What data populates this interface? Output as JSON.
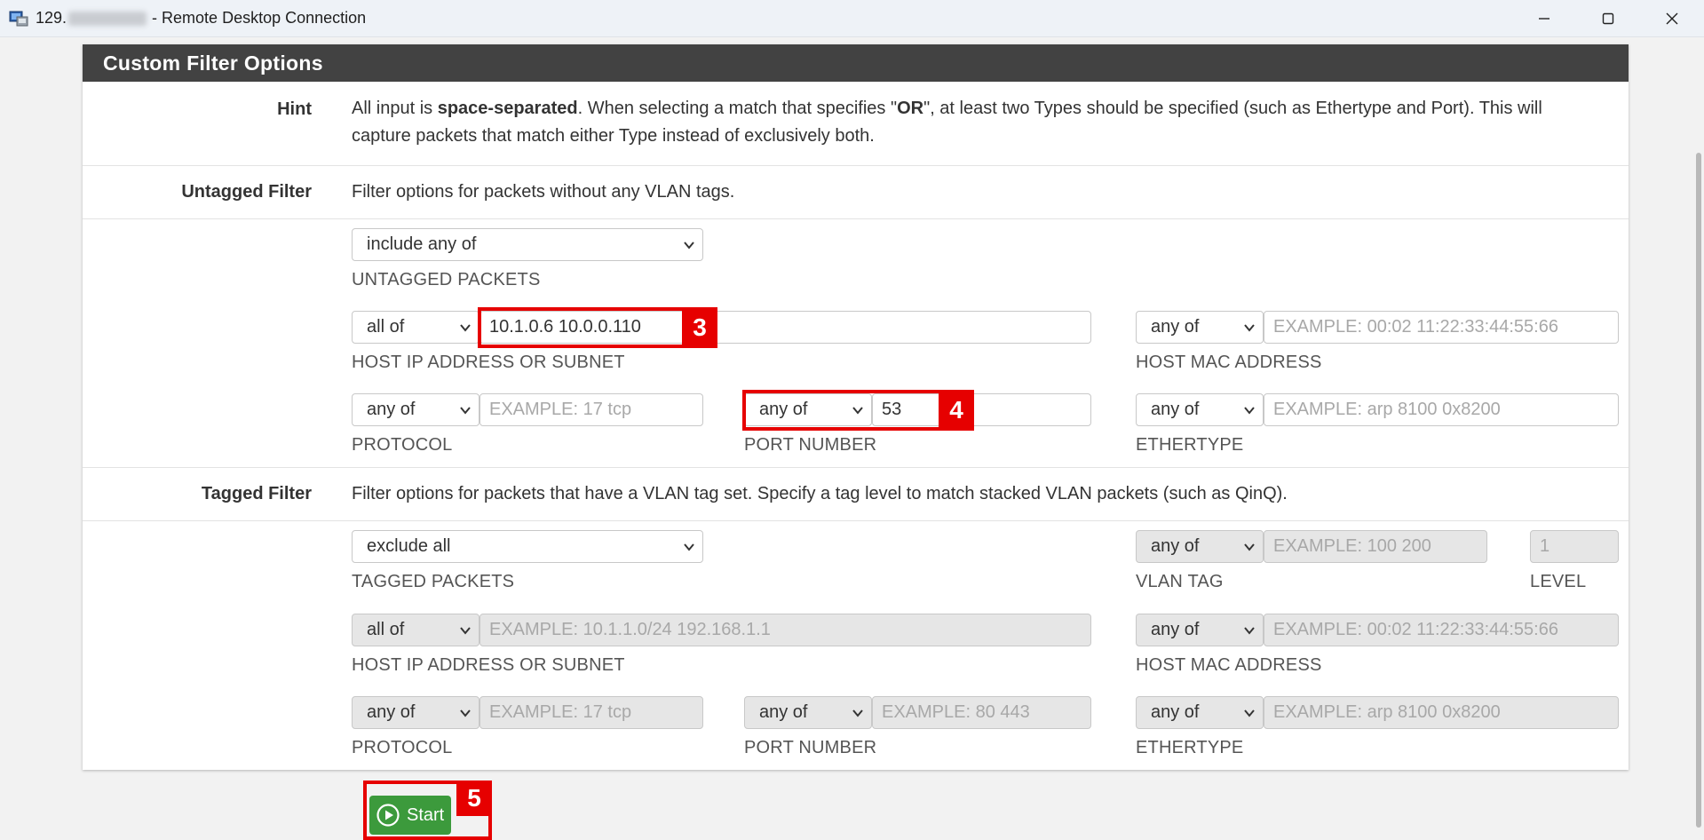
{
  "window": {
    "title_prefix": "129.",
    "title_suffix": "- Remote Desktop Connection"
  },
  "panel": {
    "heading": "Custom Filter Options"
  },
  "hint": {
    "label": "Hint",
    "text_part1": "All input is ",
    "text_bold1": "space-separated",
    "text_part2": ". When selecting a match that specifies \"",
    "text_bold2": "OR",
    "text_part3": "\", at least two Types should be specified (such as Ethertype and Port). This will",
    "text_line2": "capture packets that match either Type instead of exclusively both."
  },
  "untagged": {
    "label": "Untagged Filter",
    "description": "Filter options for packets without any VLAN tags.",
    "packets_select": "include any of",
    "packets_label": "UNTAGGED PACKETS",
    "host_ip_select": "all of",
    "host_ip_value": "10.1.0.6 10.0.0.110",
    "host_ip_label": "HOST IP ADDRESS OR SUBNET",
    "host_mac_select": "any of",
    "host_mac_placeholder": "EXAMPLE: 00:02 11:22:33:44:55:66",
    "host_mac_label": "HOST MAC ADDRESS",
    "protocol_select": "any of",
    "protocol_placeholder": "EXAMPLE: 17 tcp",
    "protocol_label": "PROTOCOL",
    "port_select": "any of",
    "port_value": "53",
    "port_label": "PORT NUMBER",
    "ethertype_select": "any of",
    "ethertype_placeholder": "EXAMPLE: arp 8100 0x8200",
    "ethertype_label": "ETHERTYPE"
  },
  "tagged": {
    "label": "Tagged Filter",
    "description": "Filter options for packets that have a VLAN tag set. Specify a tag level to match stacked VLAN packets (such as QinQ).",
    "packets_select": "exclude all",
    "packets_label": "TAGGED PACKETS",
    "vlan_select": "any of",
    "vlan_placeholder": "EXAMPLE: 100 200",
    "vlan_label": "VLAN TAG",
    "level_placeholder": "1",
    "level_label": "LEVEL",
    "host_ip_select": "all of",
    "host_ip_placeholder": "EXAMPLE: 10.1.1.0/24 192.168.1.1",
    "host_ip_label": "HOST IP ADDRESS OR SUBNET",
    "host_mac_select": "any of",
    "host_mac_placeholder": "EXAMPLE: 00:02 11:22:33:44:55:66",
    "host_mac_label": "HOST MAC ADDRESS",
    "protocol_select": "any of",
    "protocol_placeholder": "EXAMPLE: 17 tcp",
    "protocol_label": "PROTOCOL",
    "port_select": "any of",
    "port_placeholder": "EXAMPLE: 80 443",
    "port_label": "PORT NUMBER",
    "ethertype_select": "any of",
    "ethertype_placeholder": "EXAMPLE: arp 8100 0x8200",
    "ethertype_label": "ETHERTYPE"
  },
  "actions": {
    "start_label": "Start"
  },
  "annotations": {
    "badge_3": "3",
    "badge_4": "4",
    "badge_5": "5"
  },
  "colors": {
    "heading_bg": "#424242",
    "annotation_red": "#e60000",
    "start_green": "#3c9a3c"
  },
  "icons": {
    "app": "remote-desktop-icon",
    "minimize": "minimize-icon",
    "maximize": "maximize-icon",
    "close": "close-icon",
    "dropdown": "chevron-down-icon",
    "start": "play-circle-icon"
  }
}
